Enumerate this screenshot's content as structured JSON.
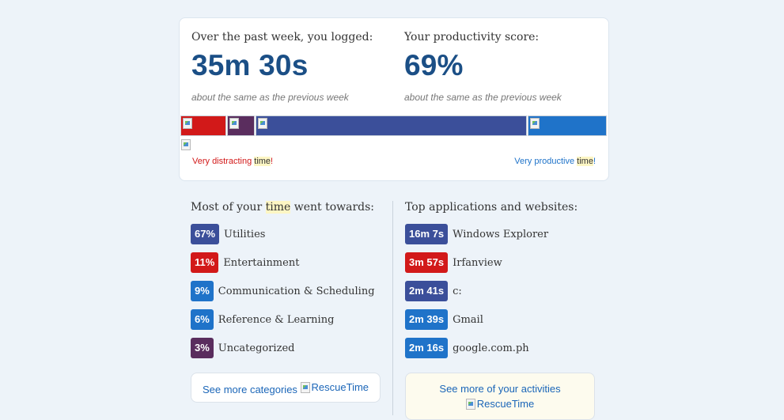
{
  "summary": {
    "logged_label": "Over the past week, you logged:",
    "logged_value": "35m 30s",
    "logged_note": "about the same as the previous week",
    "score_label": "Your productivity score:",
    "score_value": "69%",
    "score_note": "about the same as the previous week"
  },
  "productivity_bar": {
    "segments": [
      {
        "name": "very-distracting",
        "color": "#d21919",
        "share": 0.11
      },
      {
        "name": "distracting",
        "color": "#5a2d5e",
        "share": 0.066
      },
      {
        "name": "neutral",
        "color": "#3b4f9a",
        "share": 0.637
      },
      {
        "name": "productive",
        "color": "#1f73c9",
        "share": 0.187
      }
    ],
    "legend_left": {
      "pre": "Very distracting ",
      "highlight": "time",
      "post": "!"
    },
    "legend_right": {
      "pre": "Very productive ",
      "highlight": "time",
      "post": "!"
    }
  },
  "categories": {
    "heading_pre": "Most of your ",
    "heading_highlight": "time",
    "heading_post": " went towards:",
    "items": [
      {
        "badge": "67%",
        "label": "Utilities",
        "color": "#3b4f9a"
      },
      {
        "badge": "11%",
        "label": "Entertainment",
        "color": "#d21919"
      },
      {
        "badge": "9%",
        "label": "Communication & Scheduling",
        "color": "#1f73c9"
      },
      {
        "badge": "6%",
        "label": "Reference & Learning",
        "color": "#1f73c9"
      },
      {
        "badge": "3%",
        "label": "Uncategorized",
        "color": "#5a2d5e"
      }
    ],
    "more_text": "See more categories",
    "more_img_alt": "RescueTime"
  },
  "applications": {
    "heading": "Top applications and websites:",
    "items": [
      {
        "badge": "16m 7s",
        "label": "Windows Explorer",
        "color": "#3b4f9a"
      },
      {
        "badge": "3m 57s",
        "label": "Irfanview",
        "color": "#d21919"
      },
      {
        "badge": "2m 41s",
        "label": "c:",
        "color": "#3b4f9a"
      },
      {
        "badge": "2m 39s",
        "label": "Gmail",
        "color": "#1f73c9"
      },
      {
        "badge": "2m 16s",
        "label": "google.com.ph",
        "color": "#1f73c9"
      }
    ],
    "more_text": "See more of your activities",
    "more_img_alt": "RescueTime"
  }
}
